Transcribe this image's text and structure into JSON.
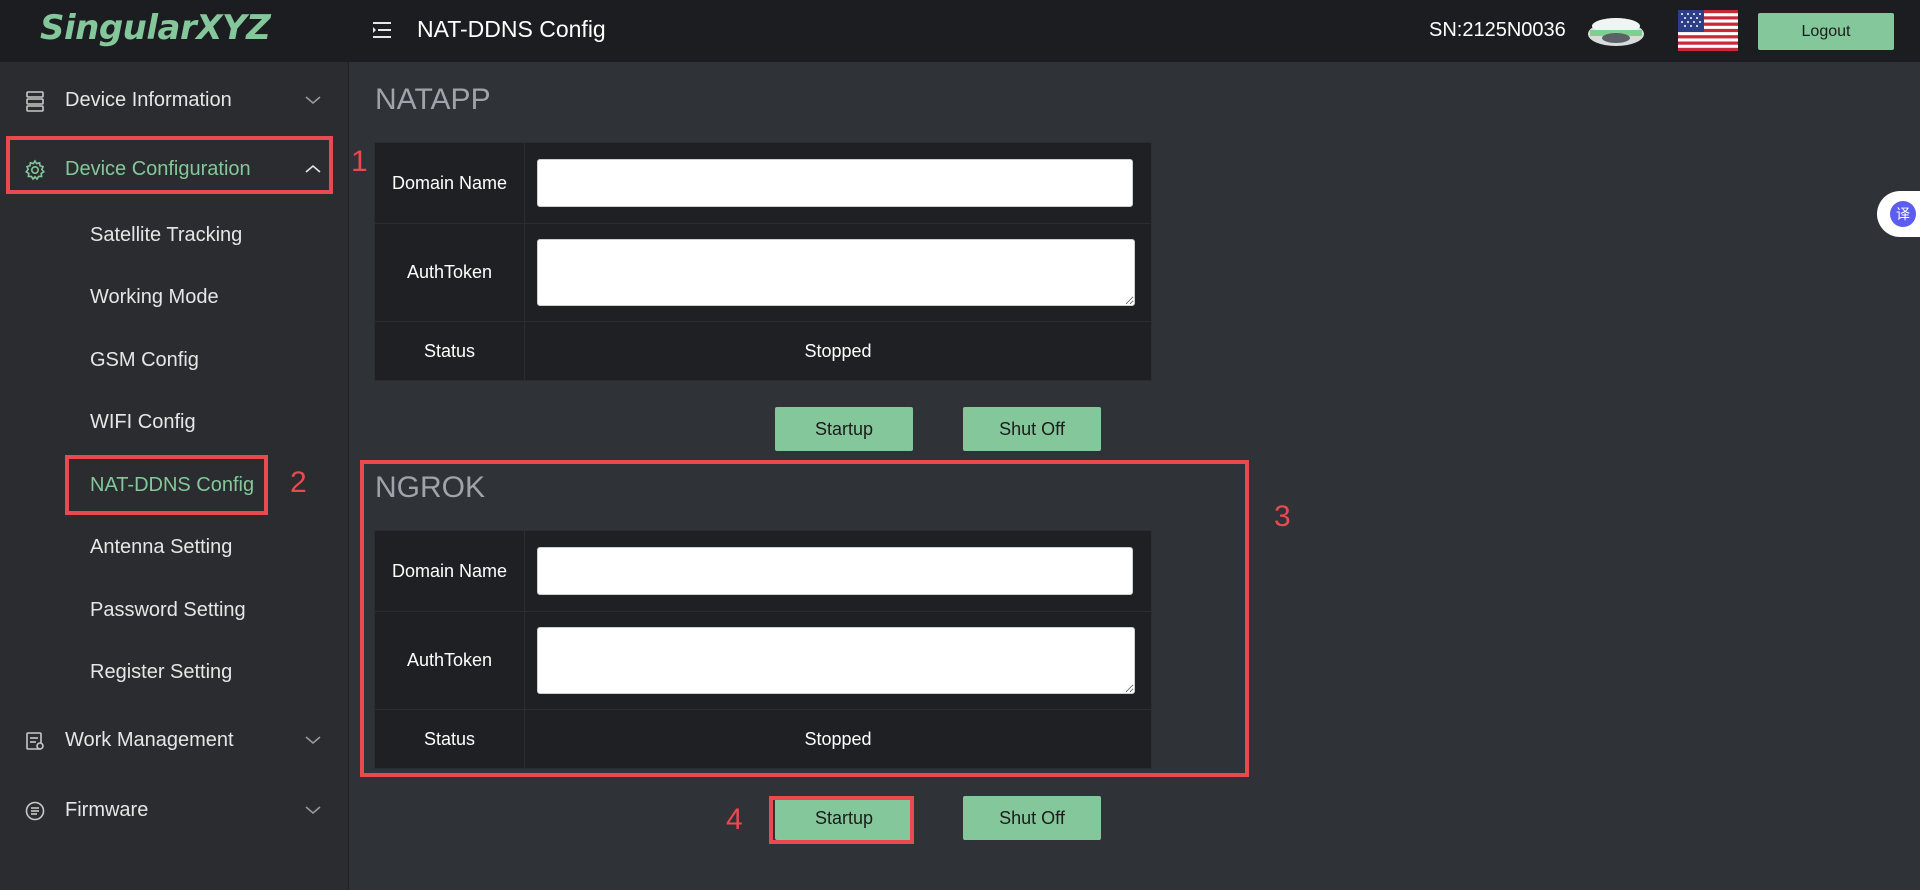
{
  "header": {
    "logo": "SingularXYZ",
    "title": "NAT-DDNS Config",
    "serial": "SN:2125N0036",
    "logout_label": "Logout"
  },
  "sidebar": {
    "items": [
      {
        "label": "Device Information",
        "icon": "server-icon"
      },
      {
        "label": "Device Configuration",
        "icon": "gear-icon"
      },
      {
        "label": "Work Management",
        "icon": "work-icon"
      },
      {
        "label": "Firmware",
        "icon": "firmware-icon"
      }
    ],
    "sub_items": [
      {
        "label": "Satellite Tracking"
      },
      {
        "label": "Working Mode"
      },
      {
        "label": "GSM Config"
      },
      {
        "label": "WIFI Config"
      },
      {
        "label": "NAT-DDNS Config"
      },
      {
        "label": "Antenna Setting"
      },
      {
        "label": "Password Setting"
      },
      {
        "label": "Register Setting"
      }
    ]
  },
  "natapp": {
    "title": "NATAPP",
    "domain_label": "Domain Name",
    "domain_value": "",
    "authtoken_label": "AuthToken",
    "authtoken_value": "",
    "status_label": "Status",
    "status_value": "Stopped",
    "startup_label": "Startup",
    "shutoff_label": "Shut Off"
  },
  "ngrok": {
    "title": "NGROK",
    "domain_label": "Domain Name",
    "domain_value": "",
    "authtoken_label": "AuthToken",
    "authtoken_value": "",
    "status_label": "Status",
    "status_value": "Stopped",
    "startup_label": "Startup",
    "shutoff_label": "Shut Off"
  },
  "annotations": [
    "1",
    "2",
    "3",
    "4"
  ],
  "translate_button": "译",
  "colors": {
    "accent": "#84c79a",
    "annotation": "#e84a4f",
    "header_bg": "#1c1d20",
    "sidebar_bg": "#2a2c30",
    "content_bg": "#2f3237"
  }
}
